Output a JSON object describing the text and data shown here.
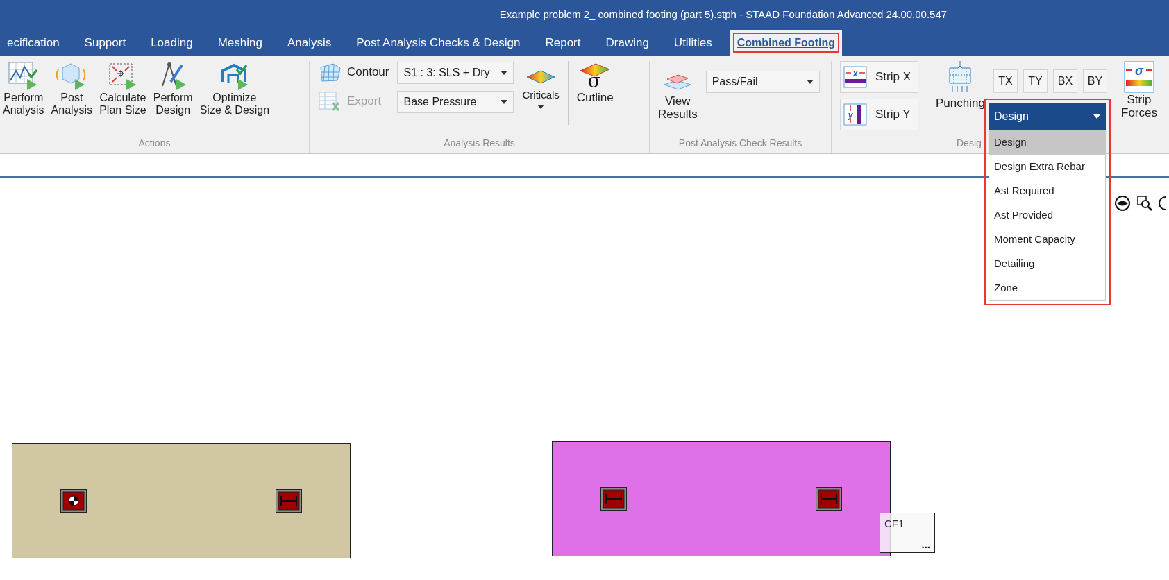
{
  "window": {
    "title": "Example problem 2_ combined footing (part 5).stph - STAAD Foundation Advanced 24.00.00.547"
  },
  "tabs": [
    {
      "label": "ecification",
      "selected": false
    },
    {
      "label": "Support",
      "selected": false
    },
    {
      "label": "Loading",
      "selected": false
    },
    {
      "label": "Meshing",
      "selected": false
    },
    {
      "label": "Analysis",
      "selected": false
    },
    {
      "label": "Post Analysis Checks & Design",
      "selected": false
    },
    {
      "label": "Report",
      "selected": false
    },
    {
      "label": "Drawing",
      "selected": false
    },
    {
      "label": "Utilities",
      "selected": false
    },
    {
      "label": "Combined Footing",
      "selected": true
    }
  ],
  "ribbon": {
    "actions": {
      "label": "Actions",
      "buttons": [
        {
          "kind": "analysis",
          "lines": [
            "Perform",
            "Analysis"
          ]
        },
        {
          "kind": "post",
          "lines": [
            "Post",
            "Analysis"
          ]
        },
        {
          "kind": "plan",
          "lines": [
            "Calculate",
            "Plan Size"
          ]
        },
        {
          "kind": "design",
          "lines": [
            "Perform",
            "Design"
          ]
        },
        {
          "kind": "optimize",
          "lines": [
            "Optimize",
            "Size & Design"
          ]
        }
      ]
    },
    "analysis_results": {
      "label": "Analysis Results",
      "buttons": [
        {
          "kind": "contour",
          "label": "Contour",
          "disabled": false
        },
        {
          "kind": "export",
          "label": "Export",
          "disabled": true
        }
      ],
      "selects": [
        {
          "value": "S1 : 3: SLS + Dry"
        },
        {
          "value": "Base Pressure"
        }
      ],
      "criticals": "Criticals",
      "cutline": "Cutline",
      "cutline_symbol": "σ"
    },
    "post_check": {
      "label": "Post Analysis Check Results",
      "view_results": [
        "View",
        "Results"
      ],
      "select": {
        "value": "Pass/Fail"
      }
    },
    "design": {
      "label": "Desig",
      "strips": [
        {
          "kind": "x",
          "label": "Strip X"
        },
        {
          "kind": "y",
          "label": "Strip Y"
        }
      ],
      "punching": "Punching",
      "small_buttons": [
        "TX",
        "TY",
        "BX",
        "BY"
      ],
      "dropdown": {
        "value": "Design",
        "options": [
          {
            "label": "Design",
            "selected": true
          },
          {
            "label": "Design Extra Rebar",
            "selected": false
          },
          {
            "label": "Ast Required",
            "selected": false
          },
          {
            "label": "Ast Provided",
            "selected": false
          },
          {
            "label": "Moment Capacity",
            "selected": false
          },
          {
            "label": "Detailing",
            "selected": false
          },
          {
            "label": "Zone",
            "selected": false
          }
        ]
      }
    },
    "strip_forces": [
      "Strip",
      "Forces"
    ],
    "strip_forces_symbol": "σ"
  },
  "canvas": {
    "footings": [
      {
        "color": "#d1c8a3",
        "columns": [
          {
            "kind": "origin"
          },
          {
            "kind": "plain"
          }
        ]
      },
      {
        "color": "#e070e8",
        "columns": [
          {
            "kind": "plain"
          },
          {
            "kind": "plain"
          }
        ]
      }
    ],
    "tag": {
      "label": "CF1",
      "more": "..."
    }
  }
}
